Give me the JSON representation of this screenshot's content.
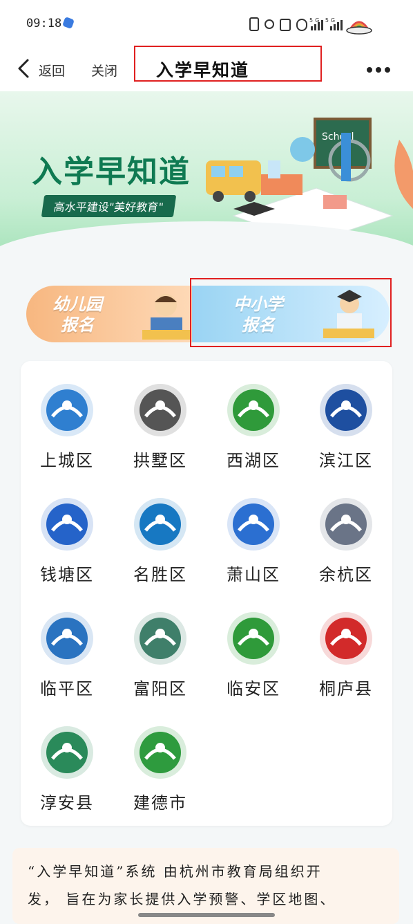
{
  "status_bar": {
    "time": "09:18",
    "icons_text": "5G 5G"
  },
  "nav": {
    "back_label": "返回",
    "close_label": "关闭",
    "title": "入学早知道"
  },
  "banner": {
    "title": "入学早知道",
    "subtitle": "高水平建设\"美好教育\""
  },
  "register": {
    "kindergarten": {
      "line1": "幼儿园",
      "line2": "报名"
    },
    "primary": {
      "line1": "中小学",
      "line2": "报名"
    }
  },
  "districts": [
    {
      "name": "上城区",
      "icon": "shangcheng-logo-icon",
      "color": "#2f7fd0"
    },
    {
      "name": "拱墅区",
      "icon": "gongshu-logo-icon",
      "color": "#555555"
    },
    {
      "name": "西湖区",
      "icon": "xihu-logo-icon",
      "color": "#2f9a3a"
    },
    {
      "name": "滨江区",
      "icon": "binjiang-logo-icon",
      "color": "#1e4fa0"
    },
    {
      "name": "钱塘区",
      "icon": "qiantang-logo-icon",
      "color": "#2563c9"
    },
    {
      "name": "名胜区",
      "icon": "mingsheng-logo-icon",
      "color": "#1778c2"
    },
    {
      "name": "萧山区",
      "icon": "xiaoshan-logo-icon",
      "color": "#2b6fd1"
    },
    {
      "name": "余杭区",
      "icon": "yuhang-logo-icon",
      "color": "#6a7487"
    },
    {
      "name": "临平区",
      "icon": "linping-logo-icon",
      "color": "#2a73c0"
    },
    {
      "name": "富阳区",
      "icon": "fuyang-logo-icon",
      "color": "#3f7f6a"
    },
    {
      "name": "临安区",
      "icon": "linan-logo-icon",
      "color": "#2f9a3a"
    },
    {
      "name": "桐庐县",
      "icon": "tonglu-logo-icon",
      "color": "#d22a2a"
    },
    {
      "name": "淳安县",
      "icon": "chunan-logo-icon",
      "color": "#2a8a5a"
    },
    {
      "name": "建德市",
      "icon": "jiande-logo-icon",
      "color": "#2e9b3e"
    }
  ],
  "info": {
    "line1": "“入学早知道”系统 由杭州市教育局组织开",
    "line2": "发， 旨在为家长提供入学预警、学区地图、"
  }
}
